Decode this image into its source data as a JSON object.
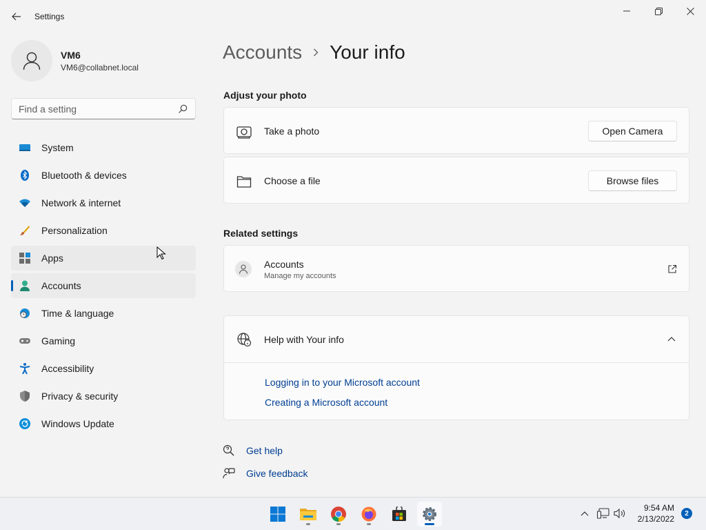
{
  "window": {
    "title": "Settings"
  },
  "user": {
    "name": "VM6",
    "email": "VM6@collabnet.local"
  },
  "search": {
    "placeholder": "Find a setting"
  },
  "nav": {
    "items": [
      {
        "label": "System"
      },
      {
        "label": "Bluetooth & devices"
      },
      {
        "label": "Network & internet"
      },
      {
        "label": "Personalization"
      },
      {
        "label": "Apps"
      },
      {
        "label": "Accounts"
      },
      {
        "label": "Time & language"
      },
      {
        "label": "Gaming"
      },
      {
        "label": "Accessibility"
      },
      {
        "label": "Privacy & security"
      },
      {
        "label": "Windows Update"
      }
    ]
  },
  "breadcrumb": {
    "parent": "Accounts",
    "current": "Your info"
  },
  "photo": {
    "title": "Adjust your photo",
    "take_photo": "Take a photo",
    "open_camera": "Open Camera",
    "choose_file": "Choose a file",
    "browse_files": "Browse files"
  },
  "related": {
    "title": "Related settings",
    "accounts_label": "Accounts",
    "accounts_sub": "Manage my accounts"
  },
  "help": {
    "title": "Help with Your info",
    "links": [
      "Logging in to your Microsoft account",
      "Creating a Microsoft account"
    ]
  },
  "footer": {
    "get_help": "Get help",
    "give_feedback": "Give feedback"
  },
  "taskbar": {
    "time": "9:54 AM",
    "date": "2/13/2022",
    "notifications": "2"
  },
  "colors": {
    "accent": "#005fb8",
    "link": "#003e92",
    "background": "#f3f3f3",
    "card": "#fbfbfb"
  }
}
